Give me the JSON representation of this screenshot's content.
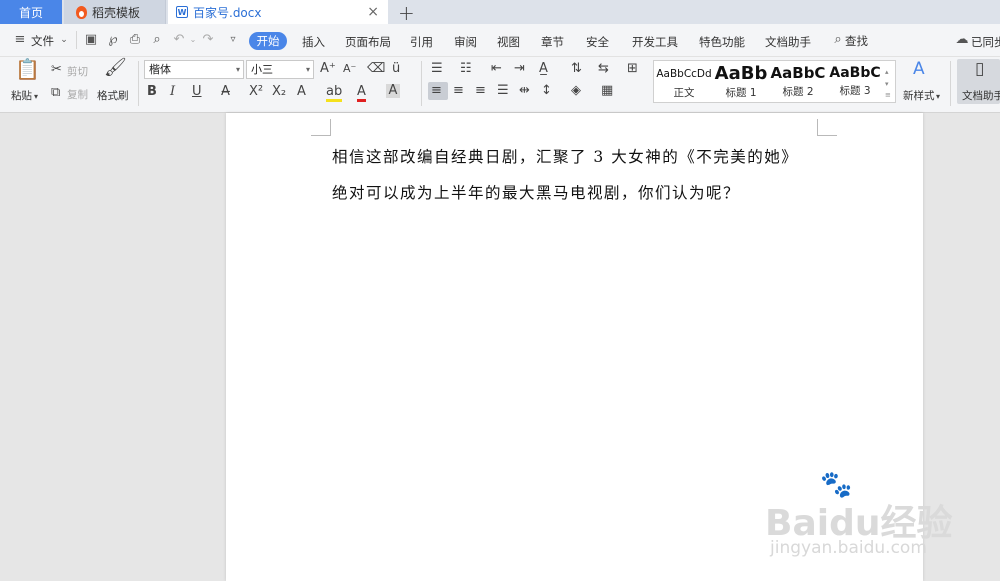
{
  "tabs": {
    "home": "首页",
    "template": "稻壳模板",
    "doc": "百家号.docx",
    "close_glyph": "×",
    "add_glyph": "+"
  },
  "menu": {
    "file": "文件",
    "items": [
      "开始",
      "插入",
      "页面布局",
      "引用",
      "审阅",
      "视图",
      "章节",
      "安全",
      "开发工具",
      "特色功能",
      "文档助手"
    ],
    "search": "查找",
    "sync": "已同步"
  },
  "ribbon": {
    "paste": "粘贴",
    "cut": "剪切",
    "copy": "复制",
    "format_painter": "格式刷",
    "font_name": "楷体",
    "font_size": "小三",
    "styles": [
      {
        "sample": "AaBbCcDd",
        "name": "正文"
      },
      {
        "sample": "AaBb",
        "name": "标题 1"
      },
      {
        "sample": "AaBbC",
        "name": "标题 2"
      },
      {
        "sample": "AaBbC",
        "name": "标题 3"
      }
    ],
    "new_style": "新样式",
    "doc_assistant": "文档助手"
  },
  "document": {
    "lines": [
      "相信这部改编自经典日剧，汇聚了 3 大女神的《不完美的她》",
      "绝对可以成为上半年的最大黑马电视剧，你们认为呢？"
    ]
  },
  "watermark": {
    "brand": "Baidu经验",
    "url": "jingyan.baidu.com"
  },
  "colors": {
    "accent": "#4a86e8",
    "tab_bar": "#dde2ea",
    "ribbon_bg": "#f4f5f7",
    "workspace": "#e6e6e6"
  }
}
